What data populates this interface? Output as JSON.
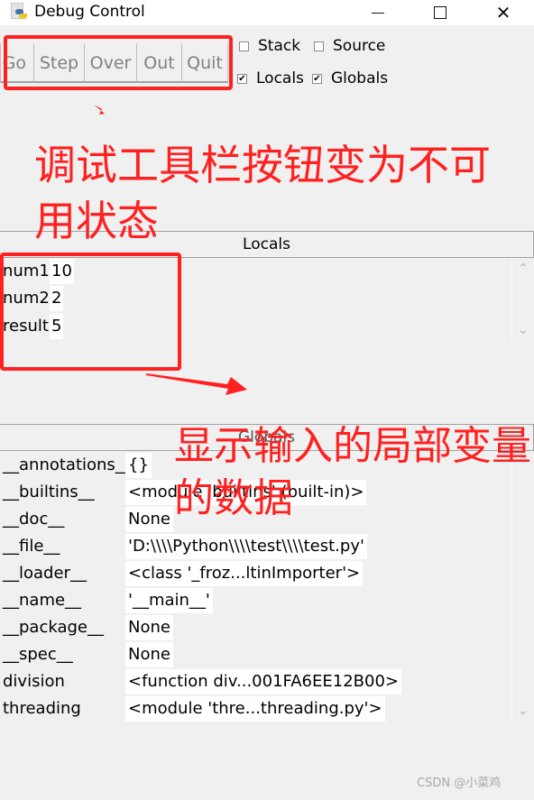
{
  "window": {
    "title": "Debug Control",
    "controls": {
      "minimize": "—",
      "maximize": "☐",
      "close": "✕"
    }
  },
  "toolbar": {
    "buttons": [
      {
        "label": "Go",
        "enabled": false
      },
      {
        "label": "Step",
        "enabled": false
      },
      {
        "label": "Over",
        "enabled": false
      },
      {
        "label": "Out",
        "enabled": false
      },
      {
        "label": "Quit",
        "enabled": false
      }
    ]
  },
  "checkboxes": [
    {
      "label": "Stack",
      "checked": false,
      "mark": ""
    },
    {
      "label": "Source",
      "checked": false,
      "mark": ""
    },
    {
      "label": "Locals",
      "checked": true,
      "mark": "✔"
    },
    {
      "label": "Globals",
      "checked": true,
      "mark": "✔"
    }
  ],
  "locals": {
    "header": "Locals",
    "rows": [
      {
        "name": "num1",
        "value": "10"
      },
      {
        "name": "num2",
        "value": "2"
      },
      {
        "name": "result",
        "value": "5"
      }
    ]
  },
  "globals": {
    "header": "Globals",
    "rows": [
      {
        "name": "__annotations__",
        "value": "{}"
      },
      {
        "name": "__builtins__",
        "value": "<module 'builtins' (built-in)>"
      },
      {
        "name": "__doc__",
        "value": "None"
      },
      {
        "name": "__file__",
        "value": "'D:\\\\\\\\Python\\\\\\\\test\\\\\\\\test.py'"
      },
      {
        "name": "__loader__",
        "value": "<class '_froz...ltinImporter'>"
      },
      {
        "name": "__name__",
        "value": "'__main__'"
      },
      {
        "name": "__package__",
        "value": "None"
      },
      {
        "name": "__spec__",
        "value": "None"
      },
      {
        "name": "division",
        "value": "<function div...001FA6EE12B00>"
      },
      {
        "name": "threading",
        "value": "<module 'thre...threading.py'>"
      }
    ]
  },
  "scrollbar": {
    "up": "⌃",
    "down": "⌄"
  },
  "annotations": {
    "toolbar_note": "调试工具栏按钮变为不可用状态",
    "locals_note": "显示输入的局部变量的数据",
    "color": "#ff2020"
  },
  "watermark": "CSDN @小菜鸡"
}
